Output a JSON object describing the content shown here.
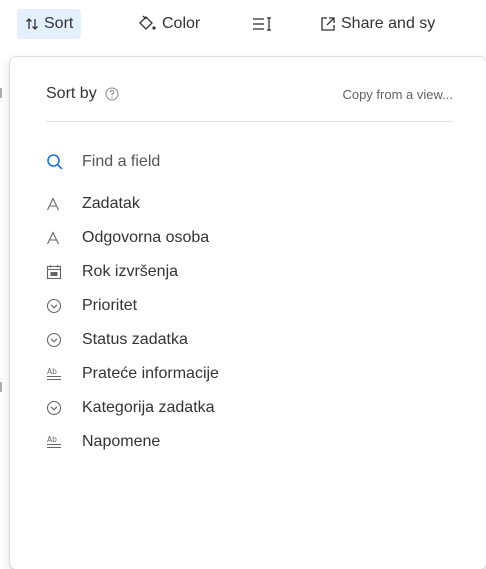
{
  "toolbar": {
    "sort_label": "Sort",
    "color_label": "Color",
    "share_label": "Share and sy"
  },
  "sort_panel": {
    "title": "Sort by",
    "copy_link": "Copy from a view...",
    "search_placeholder": "Find a field",
    "fields": [
      {
        "label": "Zadatak",
        "icon": "text-a-icon"
      },
      {
        "label": "Odgovorna osoba",
        "icon": "text-a-icon"
      },
      {
        "label": "Rok izvršenja",
        "icon": "calendar-icon"
      },
      {
        "label": "Prioritet",
        "icon": "single-select-icon"
      },
      {
        "label": "Status zadatka",
        "icon": "single-select-icon"
      },
      {
        "label": "Prateće informacije",
        "icon": "long-text-icon"
      },
      {
        "label": "Kategorija zadatka",
        "icon": "single-select-icon"
      },
      {
        "label": "Napomene",
        "icon": "long-text-icon"
      }
    ]
  },
  "colors": {
    "accent": "#1a73e8",
    "sort_button_bg": "#e3f0ff"
  }
}
